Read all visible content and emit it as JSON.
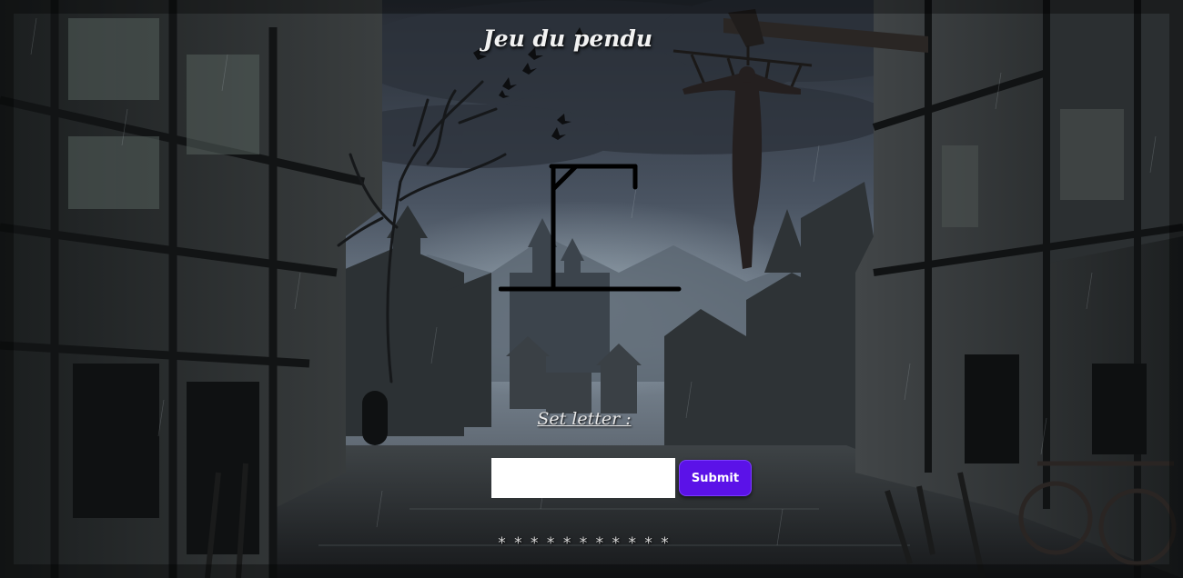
{
  "page": {
    "title": "Jeu du pendu"
  },
  "game": {
    "set_letter_label": "Set letter :",
    "letter_input_value": "",
    "submit_label": "Submit",
    "hidden_word": "* * * * * * * * * * *"
  },
  "colors": {
    "submit_background": "#5b12e8",
    "text": "#f2f2f2",
    "sky": "#3a4352"
  },
  "scene": {
    "setting": "rainy medieval village street at night",
    "icons": [
      "gallows-icon",
      "hanged-figure-icon",
      "crow-icon",
      "castle-icon"
    ]
  }
}
